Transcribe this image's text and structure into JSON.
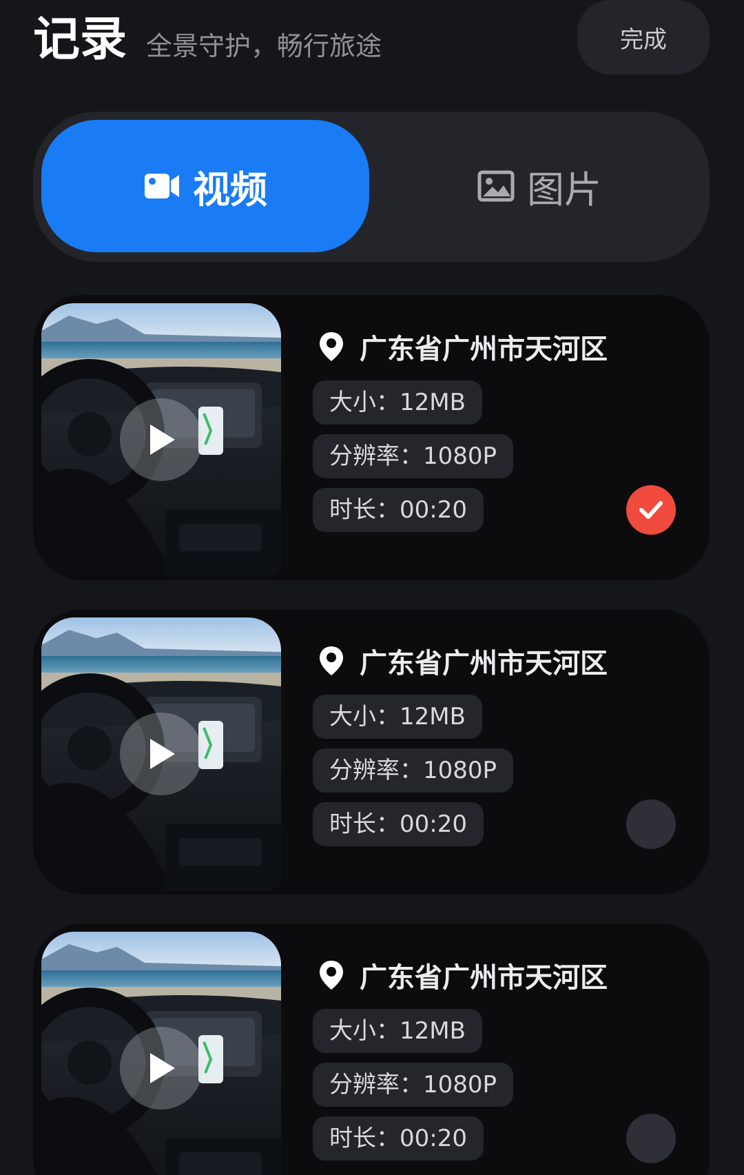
{
  "header": {
    "title": "记录",
    "subtitle": "全景守护，畅行旅途",
    "done_label": "完成"
  },
  "tabs": [
    {
      "label": "视频",
      "icon": "video-camera-icon",
      "active": true
    },
    {
      "label": "图片",
      "icon": "image-icon",
      "active": false
    }
  ],
  "records": [
    {
      "location": "广东省广州市天河区",
      "size": "大小：12MB",
      "resolution": "分辨率：1080P",
      "duration": "时长：00:20",
      "selected": true
    },
    {
      "location": "广东省广州市天河区",
      "size": "大小：12MB",
      "resolution": "分辨率：1080P",
      "duration": "时长：00:20",
      "selected": false
    },
    {
      "location": "广东省广州市天河区",
      "size": "大小：12MB",
      "resolution": "分辨率：1080P",
      "duration": "时长：00:20",
      "selected": false
    }
  ],
  "colors": {
    "background": "#15161a",
    "accent": "#1a7cf5",
    "selected": "#f04a3f",
    "card": "#0c0c0e",
    "pill": "#25262c"
  }
}
